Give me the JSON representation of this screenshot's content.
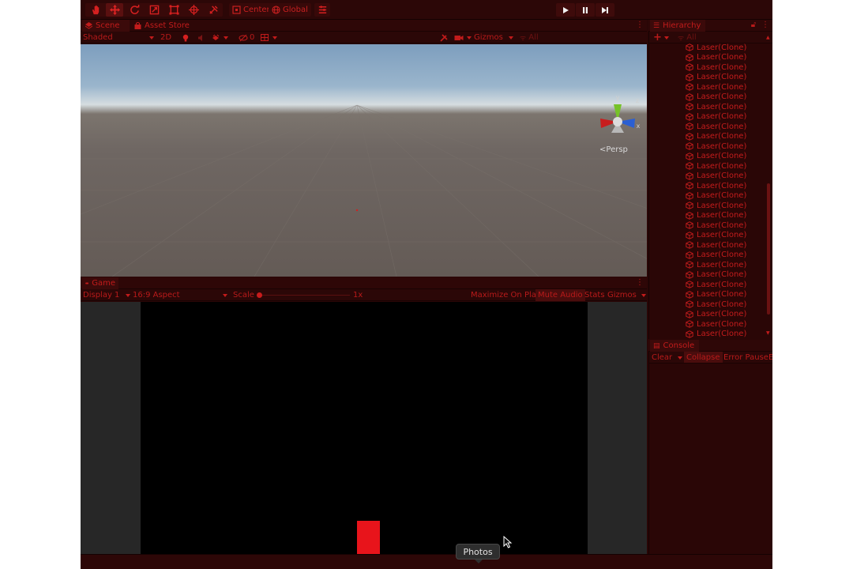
{
  "toolbar": {
    "tools": [
      "hand-tool-icon",
      "move-tool-icon",
      "rotate-tool-icon",
      "scale-tool-icon",
      "rect-tool-icon",
      "transform-tool-icon",
      "custom-tool-icon"
    ],
    "pivot_label": "Center",
    "space_label": "Global",
    "layers_icon": "layers-icon",
    "play_icon": "play-icon",
    "pause_icon": "pause-icon",
    "step_icon": "step-icon"
  },
  "scene_panel": {
    "tabs": [
      {
        "label": "Scene",
        "icon": "scene-icon",
        "active": true
      },
      {
        "label": "Asset Store",
        "icon": "asset-store-icon",
        "active": false
      }
    ],
    "shading_mode": "Shaded",
    "toggle_2d": "2D",
    "hidden_count": "0",
    "gizmos_label": "Gizmos",
    "search_placeholder": "All",
    "persp_label": "Persp",
    "axis_y": "y",
    "axis_x": "x",
    "axis_z": "z"
  },
  "game_panel": {
    "tab_label": "Game",
    "display": "Display 1",
    "aspect": "16:9 Aspect",
    "scale_label": "Scale",
    "scale_value": "1x",
    "maximize_on_play": "Maximize On Play",
    "mute_audio": "Mute Audio",
    "stats": "Stats",
    "gizmos_label": "Gizmos"
  },
  "hierarchy": {
    "tab_label": "Hierarchy",
    "add_label": "+",
    "search_placeholder": "All",
    "items": [
      "Laser(Clone)",
      "Laser(Clone)",
      "Laser(Clone)",
      "Laser(Clone)",
      "Laser(Clone)",
      "Laser(Clone)",
      "Laser(Clone)",
      "Laser(Clone)",
      "Laser(Clone)",
      "Laser(Clone)",
      "Laser(Clone)",
      "Laser(Clone)",
      "Laser(Clone)",
      "Laser(Clone)",
      "Laser(Clone)",
      "Laser(Clone)",
      "Laser(Clone)",
      "Laser(Clone)",
      "Laser(Clone)",
      "Laser(Clone)",
      "Laser(Clone)",
      "Laser(Clone)",
      "Laser(Clone)",
      "Laser(Clone)",
      "Laser(Clone)",
      "Laser(Clone)",
      "Laser(Clone)",
      "Laser(Clone)",
      "Laser(Clone)",
      "Laser(Clone)"
    ]
  },
  "console_panel": {
    "tab_label": "Console",
    "clear": "Clear",
    "collapse": "Collapse",
    "error_pause": "Error Pause",
    "truncated": "E"
  },
  "tooltip": {
    "label": "Photos"
  },
  "colors": {
    "accent": "#c41c1c",
    "panel": "#2a0606",
    "cube": "#e8141b"
  }
}
